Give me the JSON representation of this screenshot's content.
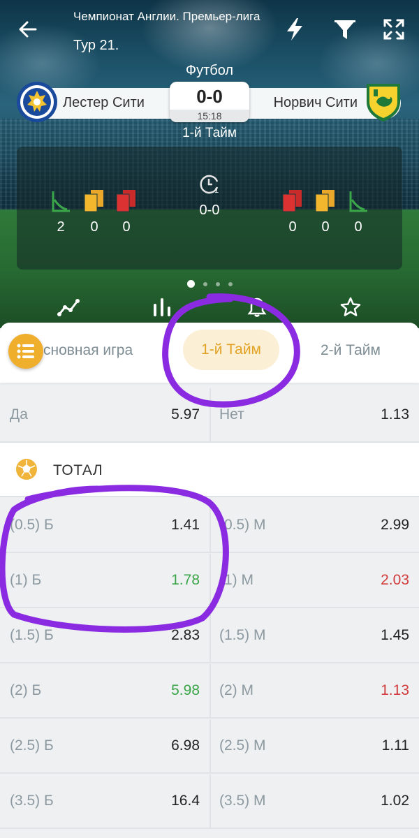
{
  "header": {
    "league": "Чемпионат Англии. Премьер-лига",
    "round": "Тур 21.",
    "sport": "Футбол",
    "home_team": "Лестер Сити",
    "away_team": "Норвич Сити",
    "score": "0-0",
    "time": "15:18",
    "period": "1-й Тайм"
  },
  "stats": {
    "home": {
      "corners": "2",
      "yellow": "0",
      "red": "0"
    },
    "away": {
      "red": "0",
      "yellow": "0",
      "corners": "0"
    },
    "center_score": "0-0",
    "clock_badge": "1"
  },
  "tabs": {
    "main": "сновная игра",
    "first_half": "1-й Тайм",
    "second_half": "2-й Тайм"
  },
  "rows": {
    "yes_no": {
      "left_label": "Да",
      "left_value": "5.97",
      "right_label": "Нет",
      "right_value": "1.13"
    }
  },
  "total": {
    "title": "ТОТАЛ",
    "rows": [
      {
        "left_label": "(0.5) Б",
        "left_value": "1.41",
        "right_label": "(0.5) М",
        "right_value": "2.99",
        "left_trend": "none",
        "right_trend": "none"
      },
      {
        "left_label": "(1) Б",
        "left_value": "1.78",
        "right_label": "(1) М",
        "right_value": "2.03",
        "left_trend": "up",
        "right_trend": "down"
      },
      {
        "left_label": "(1.5) Б",
        "left_value": "2.83",
        "right_label": "(1.5) М",
        "right_value": "1.45",
        "left_trend": "none",
        "right_trend": "none"
      },
      {
        "left_label": "(2) Б",
        "left_value": "5.98",
        "right_label": "(2) М",
        "right_value": "1.13",
        "left_trend": "up",
        "right_trend": "down"
      },
      {
        "left_label": "(2.5) Б",
        "left_value": "6.98",
        "right_label": "(2.5) М",
        "right_value": "1.11",
        "left_trend": "none",
        "right_trend": "none"
      },
      {
        "left_label": "(3.5) Б",
        "left_value": "16.4",
        "right_label": "(3.5) М",
        "right_value": "1.02",
        "left_trend": "none",
        "right_trend": "none"
      }
    ]
  },
  "icons": {
    "back": "arrow-left-icon",
    "flash": "lightning-icon",
    "filter": "funnel-icon",
    "expand": "expand-icon",
    "chart": "line-chart-icon",
    "stats": "bar-stats-icon",
    "bell": "bell-icon",
    "star": "star-icon",
    "menu": "list-menu-icon",
    "ball": "football-icon"
  },
  "colors": {
    "accent": "#efae2c",
    "active_tab_bg": "#fbefd6",
    "odds_up": "#3aa548",
    "odds_down": "#d23b3b",
    "annotation": "#8a2be2"
  }
}
